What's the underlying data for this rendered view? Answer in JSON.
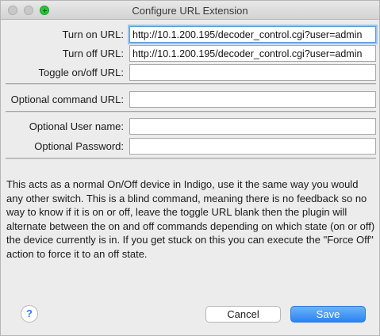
{
  "window": {
    "title": "Configure URL Extension"
  },
  "form": {
    "turn_on": {
      "label": "Turn on URL:",
      "value": "http://10.1.200.195/decoder_control.cgi?user=admin"
    },
    "turn_off": {
      "label": "Turn off URL:",
      "value": "http://10.1.200.195/decoder_control.cgi?user=admin"
    },
    "toggle": {
      "label": "Toggle on/off URL:",
      "value": ""
    },
    "command": {
      "label": "Optional command URL:",
      "value": ""
    },
    "username": {
      "label": "Optional User name:",
      "value": ""
    },
    "password": {
      "label": "Optional Password:",
      "value": ""
    }
  },
  "description": "This acts as a normal On/Off device in Indigo, use it the same way you would any other switch.  This is a blind command, meaning there is no feedback so no way to know if it is on or off, leave the toggle URL blank then the plugin will alternate between the on and off commands depending on which state (on or off) the device currently is in.  If you get stuck on this you can execute the \"Force Off\" action to force it to an off state.",
  "footer": {
    "help_label": "?",
    "cancel_label": "Cancel",
    "save_label": "Save"
  },
  "colors": {
    "accent": "#2b84f3",
    "focus_ring": "#9ec6ef"
  }
}
